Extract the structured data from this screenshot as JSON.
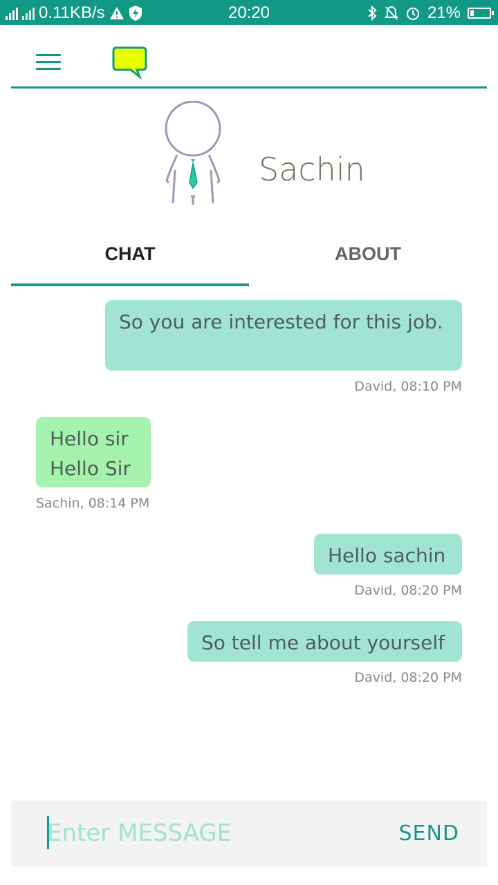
{
  "status_bar": {
    "network_speed": "0.11KB/s",
    "time": "20:20",
    "battery": "21%",
    "battery_level": 0.21,
    "icons": [
      "signal-icon",
      "warning-icon",
      "shield-icon",
      "bluetooth-icon",
      "mute-bell-icon",
      "alarm-icon",
      "battery-icon"
    ]
  },
  "app_bar": {
    "icons": [
      "menu-icon",
      "chat-bubble-logo-icon"
    ],
    "logo_color": "#e8ff00"
  },
  "profile": {
    "name": "Sachin"
  },
  "tabs": [
    {
      "label": "CHAT",
      "active": true
    },
    {
      "label": "ABOUT",
      "active": false
    }
  ],
  "messages": [
    {
      "text": "So you are interested for this job.",
      "meta": "David, 08:10 PM",
      "direction": "outgoing"
    },
    {
      "text": "Hello sir\nHello Sir",
      "meta": "Sachin, 08:14 PM",
      "direction": "incoming"
    },
    {
      "text": "Hello sachin",
      "meta": "David, 08:20 PM",
      "direction": "outgoing"
    },
    {
      "text": "So tell me about yourself",
      "meta": "David, 08:20 PM",
      "direction": "outgoing"
    }
  ],
  "composer": {
    "placeholder": "Enter MESSAGE",
    "value": "",
    "send_label": "SEND"
  },
  "colors": {
    "accent": "#129985",
    "outgoing_bubble": "#a1e4d2",
    "incoming_bubble": "#a5f2ad"
  }
}
